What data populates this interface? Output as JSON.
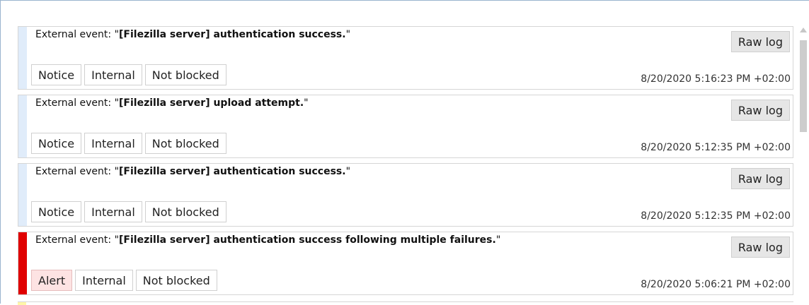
{
  "colors": {
    "notice_bar": "#e0ecfa",
    "alert_bar": "#e00000",
    "alert_tag_bg": "#fde3e3",
    "next_bar": "#fff6a8"
  },
  "events": [
    {
      "prefix": "External event: \"",
      "bold": "[Filezilla server] authentication success.",
      "suffix": "\"",
      "raw_log_label": "Raw log",
      "severity": "Notice",
      "origin": "Internal",
      "blocked": "Not blocked",
      "timestamp": "8/20/2020 5:16:23 PM +02:00"
    },
    {
      "prefix": "External event: \"",
      "bold": "[Filezilla server] upload attempt.",
      "suffix": "\"",
      "raw_log_label": "Raw log",
      "severity": "Notice",
      "origin": "Internal",
      "blocked": "Not blocked",
      "timestamp": "8/20/2020 5:12:35 PM +02:00"
    },
    {
      "prefix": "External event: \"",
      "bold": "[Filezilla server] authentication success.",
      "suffix": "\"",
      "raw_log_label": "Raw log",
      "severity": "Notice",
      "origin": "Internal",
      "blocked": "Not blocked",
      "timestamp": "8/20/2020 5:12:35 PM +02:00"
    },
    {
      "prefix": "External event: \"",
      "bold": "[Filezilla server] authentication success following multiple failures.",
      "suffix": "\"",
      "raw_log_label": "Raw log",
      "severity": "Alert",
      "origin": "Internal",
      "blocked": "Not blocked",
      "timestamp": "8/20/2020 5:06:21 PM +02:00"
    }
  ]
}
